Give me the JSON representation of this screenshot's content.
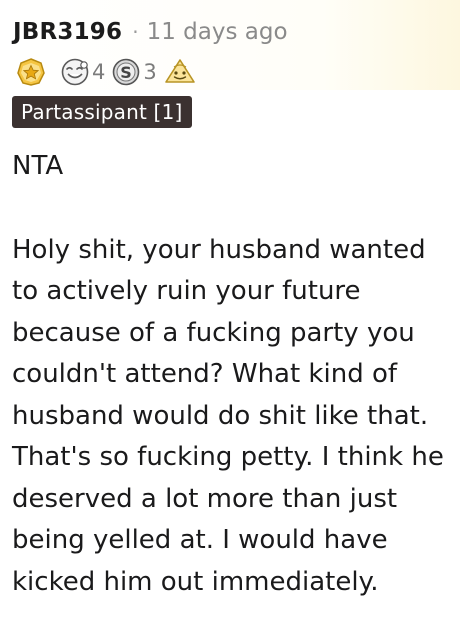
{
  "comment": {
    "username": "JBR3196",
    "separator": "·",
    "time": "11 days ago",
    "awards": [
      {
        "icon": "gold-star-award-icon",
        "count": ""
      },
      {
        "icon": "wholesome-face-award-icon",
        "count": "4"
      },
      {
        "icon": "silver-award-icon",
        "count": "3"
      },
      {
        "icon": "helpful-award-icon",
        "count": ""
      }
    ],
    "flair": "Partassipant [1]",
    "paragraphs": [
      "NTA",
      "Holy shit, your husband wanted to actively ruin your future because of a fucking party you couldn't attend? What kind of husband would do shit like that. That's so fucking petty. I think he deserved a lot more than just being yelled at. I would have kicked him out immediately."
    ]
  },
  "colors": {
    "username": "#1c1c1c",
    "timestamp": "#8a8a8a",
    "flair_background": "#3b3130",
    "flair_text": "#ffffff",
    "body_text": "#1a1a1b",
    "gold_award": "#f5c542",
    "silver_award": "#c0c0c0"
  }
}
